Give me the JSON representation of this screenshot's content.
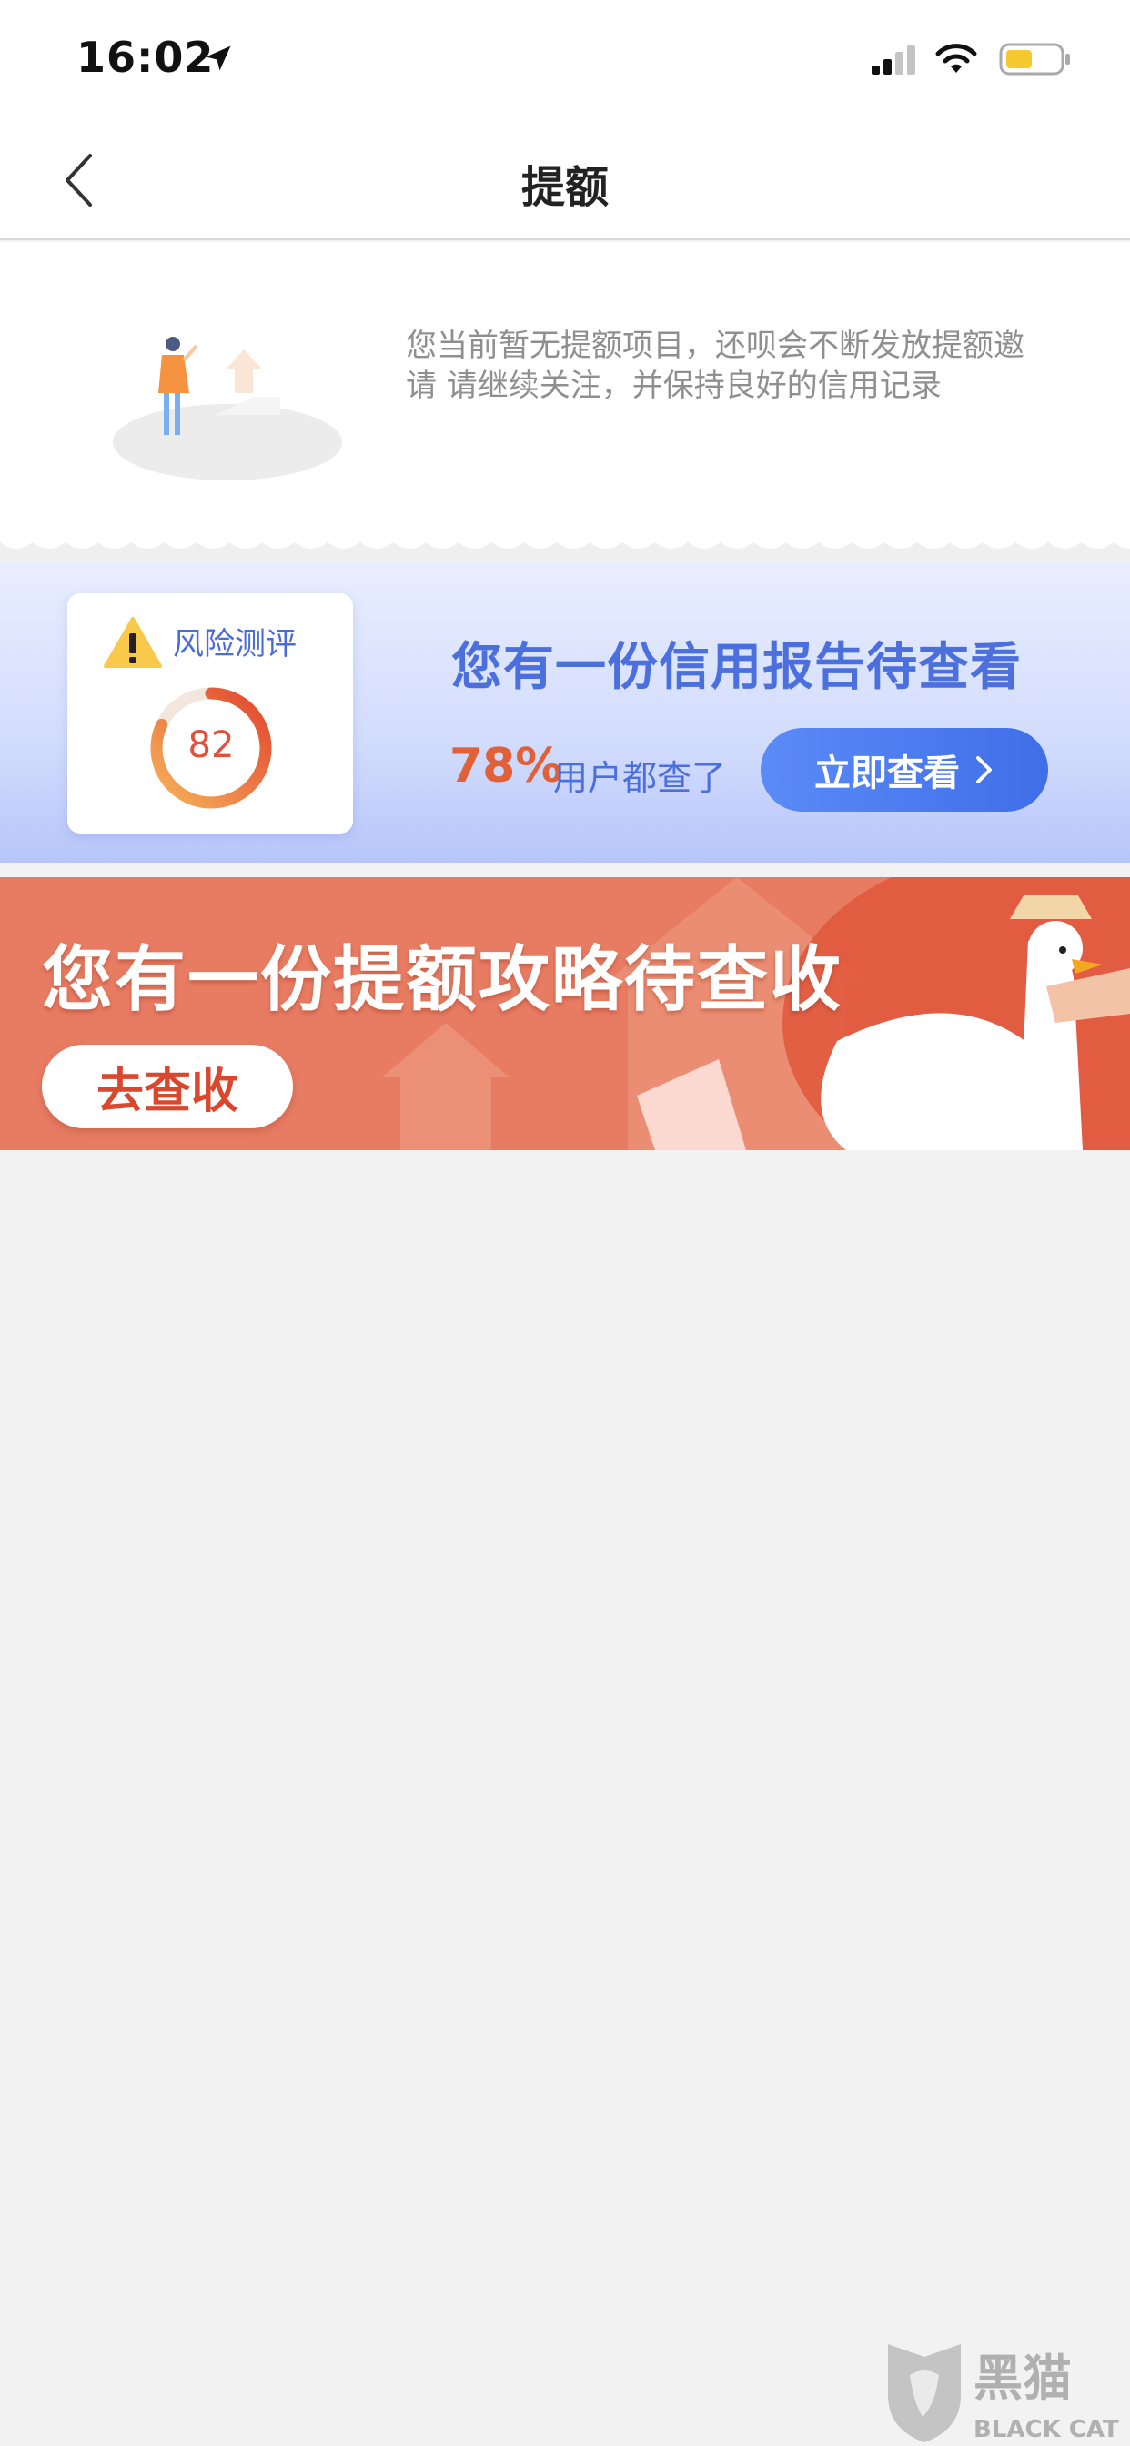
{
  "status_bar": {
    "time": "16:02"
  },
  "nav": {
    "title": "提额"
  },
  "notice": {
    "text": "您当前暂无提额项目，还呗会不断发放提额邀请 请继续关注，并保持良好的信用记录"
  },
  "credit_card": {
    "risk_label": "风险测评",
    "score": "82",
    "score_fraction": 0.82,
    "title": "您有一份信用报告待查看",
    "stat": "78%",
    "stat_suffix": "用户都查了",
    "button_label": "立即查看"
  },
  "strategy_banner": {
    "title": "您有一份提额攻略待查收",
    "button_label": "去查收"
  },
  "watermark": {
    "text_cn": "黑猫",
    "text_en": "BLACK CAT"
  },
  "colors": {
    "accent_blue": "#4b6fdc",
    "accent_orange": "#e06038",
    "banner_red": "#e77c63"
  },
  "icons": [
    "back-icon",
    "location-arrow-icon",
    "signal-icon",
    "wifi-icon",
    "battery-icon",
    "warning-icon",
    "chevron-right-icon"
  ]
}
